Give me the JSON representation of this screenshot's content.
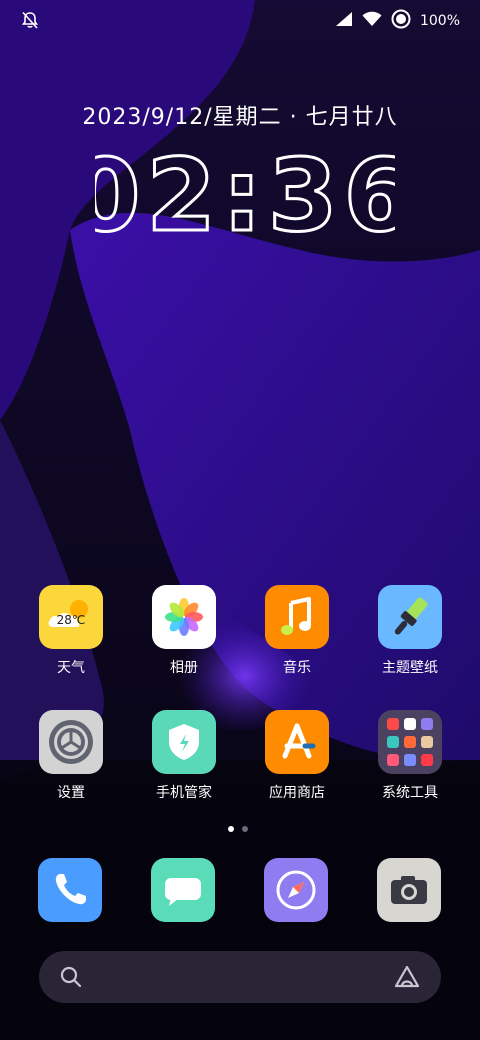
{
  "status_bar": {
    "battery_text": "100%",
    "icons": [
      "bell-muted-icon",
      "signal-icon",
      "wifi-icon",
      "data-saver-icon"
    ]
  },
  "lock": {
    "date": "2023/9/12/星期二 · 七月廿八",
    "time": "02:36"
  },
  "apps": [
    {
      "label": "天气",
      "icon": "weather-icon",
      "badge": "28℃",
      "color": "#fbd73c"
    },
    {
      "label": "相册",
      "icon": "photos-icon",
      "color": "#ffffff"
    },
    {
      "label": "音乐",
      "icon": "music-icon",
      "color": "#ff8c00"
    },
    {
      "label": "主题壁纸",
      "icon": "theme-brush-icon",
      "color": "#6ab8ff"
    },
    {
      "label": "设置",
      "icon": "settings-icon",
      "color": "#d0d0d0"
    },
    {
      "label": "手机管家",
      "icon": "phone-manager-icon",
      "color": "#5ad9b8"
    },
    {
      "label": "应用商店",
      "icon": "app-store-icon",
      "color": "#ff8c00"
    },
    {
      "label": "系统工具",
      "icon": "system-tools-folder-icon",
      "color": "#4a4260"
    }
  ],
  "pager": {
    "current": 1,
    "total": 2
  },
  "dock": [
    {
      "icon": "phone-icon",
      "color": "#4a9cff"
    },
    {
      "icon": "messages-icon",
      "color": "#5adcb8"
    },
    {
      "icon": "browser-compass-icon",
      "color": "#8e7cf0"
    },
    {
      "icon": "camera-icon",
      "color": "#d8d6d0"
    }
  ],
  "search_bar": {
    "icons": [
      "search-icon",
      "voice-assistant-icon"
    ]
  }
}
